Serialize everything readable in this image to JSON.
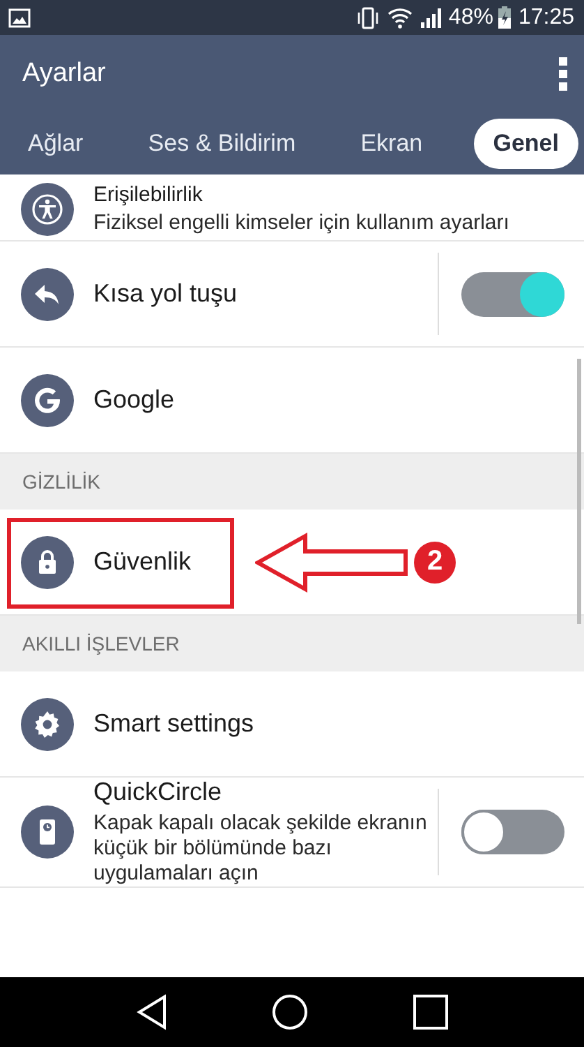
{
  "status_bar": {
    "battery": "48%",
    "time": "17:25"
  },
  "app_bar": {
    "title": "Ayarlar"
  },
  "tabs": [
    {
      "label": "Ağlar",
      "selected": false
    },
    {
      "label": "Ses & Bildirim",
      "selected": false
    },
    {
      "label": "Ekran",
      "selected": false
    },
    {
      "label": "Genel",
      "selected": true
    }
  ],
  "items": [
    {
      "kind": "row",
      "title": "Erişilebilirlik",
      "subtitle": "Fiziksel engelli kimseler için kullanım ayarları"
    },
    {
      "kind": "row",
      "title": "Kısa yol tuşu",
      "toggle": {
        "on": true
      }
    },
    {
      "kind": "row",
      "title": "Google"
    },
    {
      "kind": "header",
      "title": "GİZLİLİK"
    },
    {
      "kind": "row",
      "title": "Güvenlik",
      "highlighted": true
    },
    {
      "kind": "header",
      "title": "AKILLI İŞLEVLER"
    },
    {
      "kind": "row",
      "title": "Smart settings"
    },
    {
      "kind": "row",
      "title": "QuickCircle",
      "subtitle": "Kapak kapalı olacak şekilde ekranın küçük bir bölümünde bazı uygulamaları açın",
      "toggle": {
        "on": false
      }
    }
  ],
  "annotation": {
    "label": "2"
  }
}
